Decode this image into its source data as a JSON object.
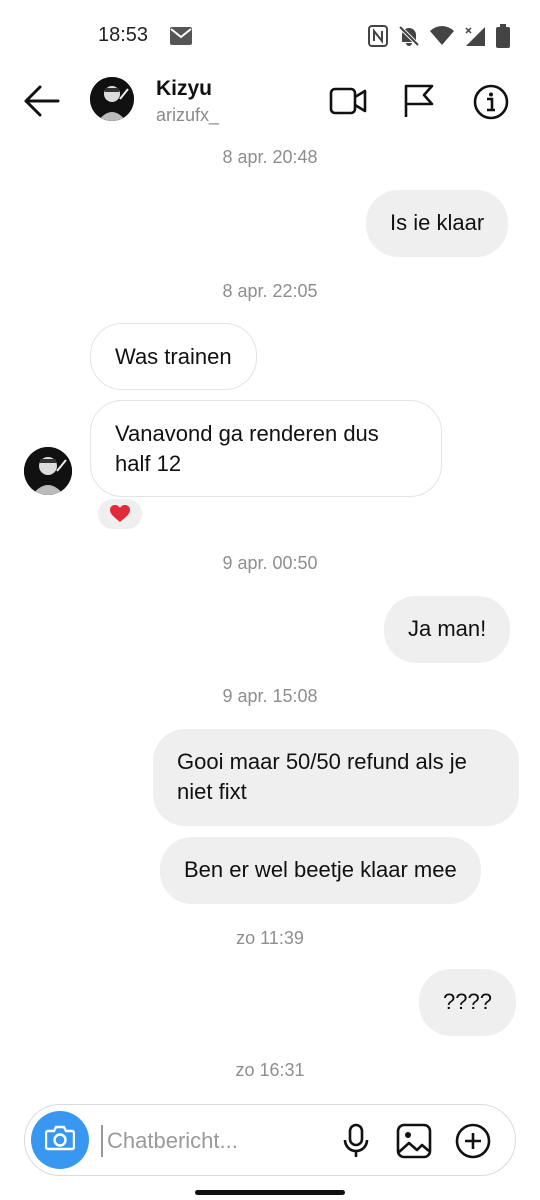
{
  "status_bar": {
    "time": "18:53",
    "icons": [
      "mail-icon",
      "nfc-icon",
      "mute-icon",
      "wifi-icon",
      "signal-icon",
      "battery-icon"
    ]
  },
  "header": {
    "contact_name": "Kizyu",
    "contact_handle": "arizufx_",
    "icons": [
      "back-arrow-icon",
      "video-call-icon",
      "flag-icon",
      "info-icon"
    ]
  },
  "messages": [
    {
      "type": "timestamp",
      "text": "8 apr. 20:48"
    },
    {
      "type": "outgoing",
      "text": "Is ie klaar"
    },
    {
      "type": "timestamp",
      "text": "8 apr. 22:05"
    },
    {
      "type": "incoming",
      "text": "Was trainen"
    },
    {
      "type": "incoming",
      "text": "Vanavond ga renderen dus half 12",
      "reaction": "❤️"
    },
    {
      "type": "timestamp",
      "text": "9 apr. 00:50"
    },
    {
      "type": "outgoing",
      "text": "Ja man!"
    },
    {
      "type": "timestamp",
      "text": "9 apr. 15:08"
    },
    {
      "type": "outgoing",
      "text": "Gooi maar 50/50 refund als je niet fixt"
    },
    {
      "type": "outgoing",
      "text": "Ben er wel beetje klaar mee"
    },
    {
      "type": "timestamp",
      "text": "zo 11:39"
    },
    {
      "type": "outgoing",
      "text": "????"
    },
    {
      "type": "timestamp",
      "text": "zo 16:31"
    }
  ],
  "composer": {
    "placeholder": "Chatbericht...",
    "icons": [
      "camera-icon",
      "microphone-icon",
      "gallery-icon",
      "add-icon"
    ]
  },
  "colors": {
    "accent": "#3897f0",
    "outgoing_bubble": "#efefef",
    "timestamp": "#8e8e8e",
    "reaction_heart": "#e02a3a"
  }
}
